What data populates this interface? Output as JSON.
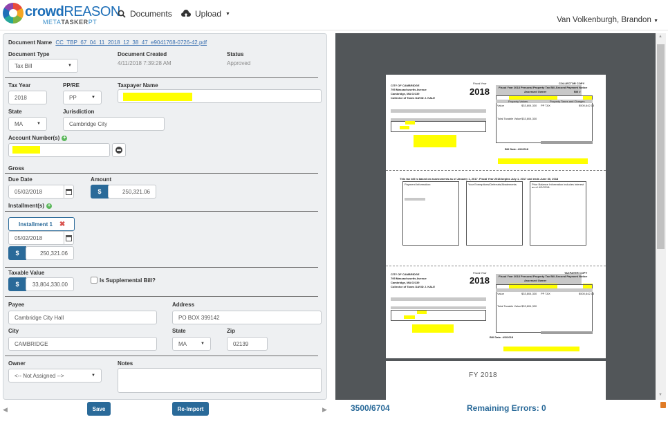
{
  "brand": {
    "name_a": "crowd",
    "name_b": "REASON",
    "sub_a": "META",
    "sub_b": "TASKER",
    "sub_c": "PT"
  },
  "nav": {
    "documents": "Documents",
    "upload": "Upload",
    "user": "Van Volkenburgh, Brandon"
  },
  "form": {
    "document_name_label": "Document Name",
    "document_name": "CC_TBP_67_04_11_2018_12_38_47_e9041768-0726-42.pdf",
    "document_type_label": "Document Type",
    "document_type": "Tax Bill",
    "document_created_label": "Document Created",
    "document_created": "4/11/2018 7:39:28 AM",
    "status_label": "Status",
    "status": "Approved",
    "tax_year_label": "Tax Year",
    "tax_year": "2018",
    "pp_re_label": "PP/RE",
    "pp_re": "PP",
    "taxpayer_name_label": "Taxpayer Name",
    "state_label": "State",
    "state": "MA",
    "jurisdiction_label": "Jurisdiction",
    "jurisdiction": "Cambridge City",
    "account_numbers_label": "Account Number(s)",
    "gross_label": "Gross",
    "due_date_label": "Due Date",
    "due_date": "05/02/2018",
    "amount_label": "Amount",
    "amount": "250,321.06",
    "currency_symbol": "$",
    "installments_label": "Installment(s)",
    "installment_tab": "Installment 1",
    "installment_due_date": "05/02/2018",
    "installment_amount": "250,321.06",
    "taxable_value_label": "Taxable Value",
    "taxable_value": "33,804,330.00",
    "supplemental_label": "Is Supplemental Bill?",
    "payee_label": "Payee",
    "payee": "Cambridge City Hall",
    "address_label": "Address",
    "address": "PO BOX 399142",
    "city_label": "City",
    "city": "CAMBRIDGE",
    "state2_label": "State",
    "state2": "MA",
    "zip_label": "Zip",
    "zip": "02139",
    "owner_label": "Owner",
    "owner": "<-- Not Assigned -->",
    "notes_label": "Notes"
  },
  "actions": {
    "save": "Save",
    "reimport": "Re-Import"
  },
  "footer": {
    "counter": "3500/6704",
    "remaining_errors": "Remaining Errors: 0"
  },
  "document": {
    "collector_copy": "COLLECTOR COPY",
    "taxpayer_copy": "TAXPAYER COPY",
    "city": "CITY OF CAMBRIDGE",
    "street": "795 Massachusetts Avenue",
    "citystate": "Cambridge, MA  02139",
    "collector": "Collector of Taxes DAVID J. KALE",
    "fiscal_year_label": "Fiscal Year",
    "year": "2018",
    "notice_title": "Fiscal Year 2018 Personal Property Tax Bill-Second Payment Notice",
    "assessed_owner": "Assessed Owner",
    "bill_no": "Bill #",
    "property_values": "Property Values",
    "property_taxes": "Property Taxes and Charges",
    "value_label": "Value",
    "value_amount": "$33,804,330",
    "pp_tax": "PP TAX",
    "pp_tax_amount": "$500,642.13",
    "total_taxable": "Total Taxable Value",
    "total_taxable_amount": "$33,804,330",
    "bill_date": "Bill Date: 4/2/2018",
    "notice_line": "This tax bill is based on assessments as of January 1, 2017.  Fiscal Year 2018 begins July 1, 2017 and ends June 30, 2018",
    "payment_info": "Payment Information:",
    "exemptions": "Your Exemptions/Deferrals/Abatements",
    "prior_balance": "Prior Balance Information includes interest as of 4/2/2018:",
    "fy_footer": "FY 2018"
  }
}
